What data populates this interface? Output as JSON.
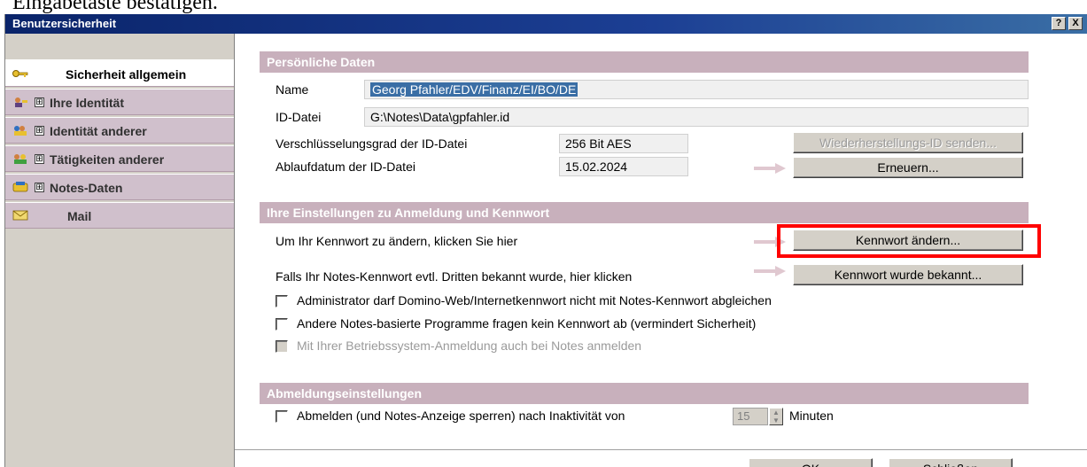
{
  "background": {
    "heading_fragment": "Eingabetaste bestätigen."
  },
  "dialog": {
    "title": "Benutzersicherheit",
    "help_button": "?",
    "close_button": "X"
  },
  "nav": {
    "items": [
      {
        "label": "Sicherheit allgemein",
        "expander": "",
        "icon": "key-icon",
        "active": true
      },
      {
        "label": "Ihre Identität",
        "expander": "⊞",
        "icon": "identity-icon"
      },
      {
        "label": "Identität anderer",
        "expander": "⊞",
        "icon": "identity-others-icon"
      },
      {
        "label": "Tätigkeiten anderer",
        "expander": "⊞",
        "icon": "activities-icon"
      },
      {
        "label": "Notes-Daten",
        "expander": "⊞",
        "icon": "notes-data-icon"
      },
      {
        "label": "Mail",
        "expander": "",
        "icon": "mail-icon"
      }
    ]
  },
  "personal": {
    "header": "Persönliche Daten",
    "name_label": "Name",
    "name_value": "Georg Pfahler/EDV/Finanz/EI/BO/DE",
    "iddatei_label": "ID-Datei",
    "iddatei_value": "G:\\Notes\\Data\\gpfahler.id",
    "encryption_label": "Verschlüsselungsgrad der ID-Datei",
    "encryption_value": "256 Bit AES",
    "expiry_label": "Ablaufdatum der ID-Datei",
    "expiry_value": "15.02.2024",
    "recovery_button": "Wiederherstellungs-ID senden...",
    "renew_button": "Erneuern..."
  },
  "login": {
    "header": "Ihre Einstellungen zu Anmeldung und Kennwort",
    "change_text": "Um Ihr Kennwort zu ändern, klicken Sie hier",
    "change_button": "Kennwort ändern...",
    "known_text": "Falls Ihr Notes-Kennwort evtl. Dritten bekannt wurde, hier klicken",
    "known_button": "Kennwort wurde bekannt...",
    "checkboxes": [
      {
        "label": "Administrator darf Domino-Web/Internetkennwort nicht mit Notes-Kennwort abgleichen",
        "checked": false,
        "disabled": false
      },
      {
        "label": "Andere Notes-basierte Programme fragen kein Kennwort ab (vermindert Sicherheit)",
        "checked": false,
        "disabled": false
      },
      {
        "label": "Mit Ihrer Betriebssystem-Anmeldung auch bei Notes anmelden",
        "checked": false,
        "disabled": true
      }
    ]
  },
  "logout": {
    "header": "Abmeldungseinstellungen",
    "checkbox_label": "Abmelden (und Notes-Anzeige sperren) nach Inaktivität von",
    "minutes_value": "15",
    "minutes_unit": "Minuten"
  },
  "footer": {
    "ok_button": "OK",
    "close_button": "Schließen"
  },
  "colors": {
    "title_bar": "#0a246a",
    "section_header": "#c8b0bc",
    "nav_item": "#d0c0cc",
    "highlight": "#ff0000",
    "selection": "#3a6ea5"
  }
}
